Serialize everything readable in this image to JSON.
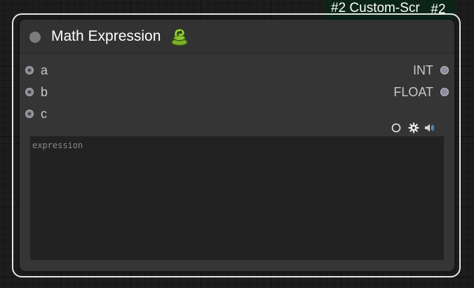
{
  "badge": {
    "title": "#2 Custom-Scr",
    "id": "#2"
  },
  "node": {
    "title": "Math Expression",
    "title_icon": "snake-icon",
    "inputs": [
      "a",
      "b",
      "c"
    ],
    "outputs": [
      "INT",
      "FLOAT"
    ],
    "toolbar_icons": [
      "circle-icon",
      "gear-icon",
      "speaker-icon"
    ],
    "expression": {
      "value": "",
      "placeholder": "expression"
    }
  },
  "colors": {
    "canvas": "#1d1d1d",
    "node_body": "#353535",
    "textarea": "#222222",
    "badge_bg": "#0b2418",
    "selection": "#e6e6e6"
  }
}
